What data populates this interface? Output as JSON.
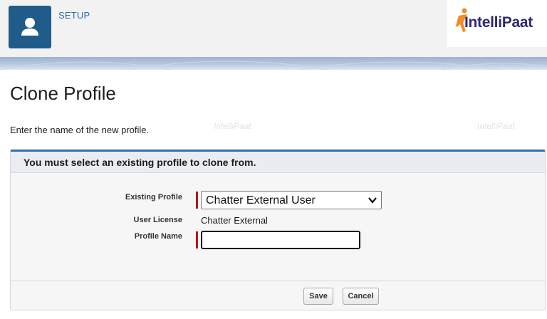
{
  "header": {
    "setup_label": "SETUP",
    "setup_icon": "user-icon",
    "brand_logo": "IntelliPaat",
    "brand_color": "#2e2a6e",
    "brand_accent": "#f28c28"
  },
  "page": {
    "title": "Clone Profile",
    "instructions": "Enter the name of the new profile."
  },
  "panel": {
    "header_text": "You must select an existing profile to clone from.",
    "accent_color": "#2a6fb0",
    "fields": {
      "existing_profile": {
        "label": "Existing Profile",
        "selected_value": "Chatter External User",
        "required": true
      },
      "user_license": {
        "label": "User License",
        "value": "Chatter External"
      },
      "profile_name": {
        "label": "Profile Name",
        "value": "",
        "required": true
      }
    },
    "buttons": {
      "save_label": "Save",
      "cancel_label": "Cancel"
    }
  },
  "required_marker_color": "#b3161c"
}
